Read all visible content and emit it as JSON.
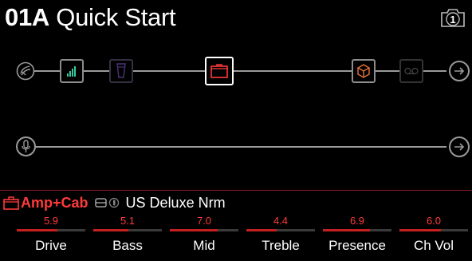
{
  "preset": {
    "slot": "01A",
    "name": "Quick Start"
  },
  "snapshot": {
    "number": "1"
  },
  "path1": {
    "input": "guitar-input-icon",
    "blocks": [
      {
        "name": "compressor-block",
        "icon": "signal-bars-icon",
        "state": "on"
      },
      {
        "name": "wah-block",
        "icon": "wah-pedal-icon",
        "state": "bypassed"
      },
      {
        "name": "amp-cab-block",
        "icon": "amp-icon",
        "state": "selected"
      },
      {
        "name": "reverb-block",
        "icon": "cube-icon",
        "state": "on"
      },
      {
        "name": "looper-block",
        "icon": "looper-icon",
        "state": "bypassed"
      }
    ],
    "output": "output-arrow-icon"
  },
  "path2": {
    "input": "microphone-input-icon",
    "output": "output-arrow-icon"
  },
  "selected_model": {
    "category": "Amp+Cab",
    "icons": [
      "speaker-cab-icon",
      "mic-icon"
    ],
    "name": "US Deluxe Nrm"
  },
  "params": [
    {
      "label": "Drive",
      "value": "5.9",
      "level": 0.59
    },
    {
      "label": "Bass",
      "value": "5.1",
      "level": 0.51
    },
    {
      "label": "Mid",
      "value": "7.0",
      "level": 0.7
    },
    {
      "label": "Treble",
      "value": "4.4",
      "level": 0.44
    },
    {
      "label": "Presence",
      "value": "6.9",
      "level": 0.69
    },
    {
      "label": "Ch Vol",
      "value": "6.0",
      "level": 0.6
    }
  ],
  "colors": {
    "accent": "#ff3a3a",
    "path": "#9a9a9a",
    "reverb": "#e8733a",
    "compressor": "#37c9a0",
    "wah": "#7b4ccf"
  }
}
